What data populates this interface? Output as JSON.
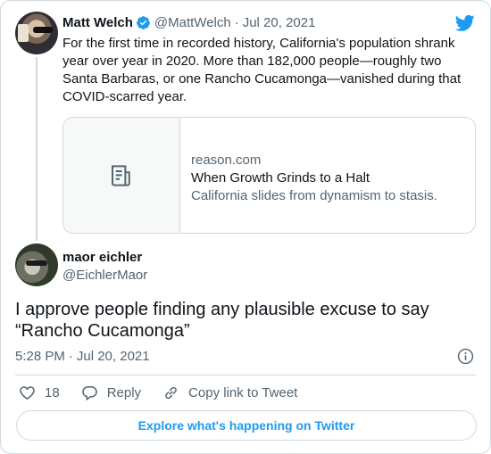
{
  "quoted_tweet": {
    "author_name": "Matt Welch",
    "author_handle": "@MattWelch",
    "separator": "·",
    "date": "Jul 20, 2021",
    "text": "For the first time in recorded history, California's population shrank year over year in 2020. More than 182,000 people—roughly two Santa Barbaras, or one Rancho Cucamonga—vanished during that COVID-scarred year.",
    "link_card": {
      "domain": "reason.com",
      "title": "When Growth Grinds to a Halt",
      "description": "California slides from dynamism to stasis."
    }
  },
  "reply": {
    "author_name": "maor eichler",
    "author_handle": "@EichlerMaor",
    "text": "I approve people finding any plausible excuse to say “Rancho Cucamonga”",
    "time": "5:28 PM",
    "separator": "·",
    "date": "Jul 20, 2021"
  },
  "actions": {
    "like_count": "18",
    "reply_label": "Reply",
    "copy_link_label": "Copy link to Tweet"
  },
  "explore_button_label": "Explore what's happening on Twitter",
  "colors": {
    "accent": "#1d9bf0",
    "text_primary": "#0f1419",
    "text_secondary": "#536471",
    "border": "#cfd9de"
  },
  "icons": {
    "brand": "twitter-bird-icon",
    "verified": "verified-badge-icon",
    "link_thumb": "article-icon",
    "info": "info-icon",
    "like": "heart-icon",
    "reply": "reply-bubble-icon",
    "copy_link": "link-icon"
  }
}
